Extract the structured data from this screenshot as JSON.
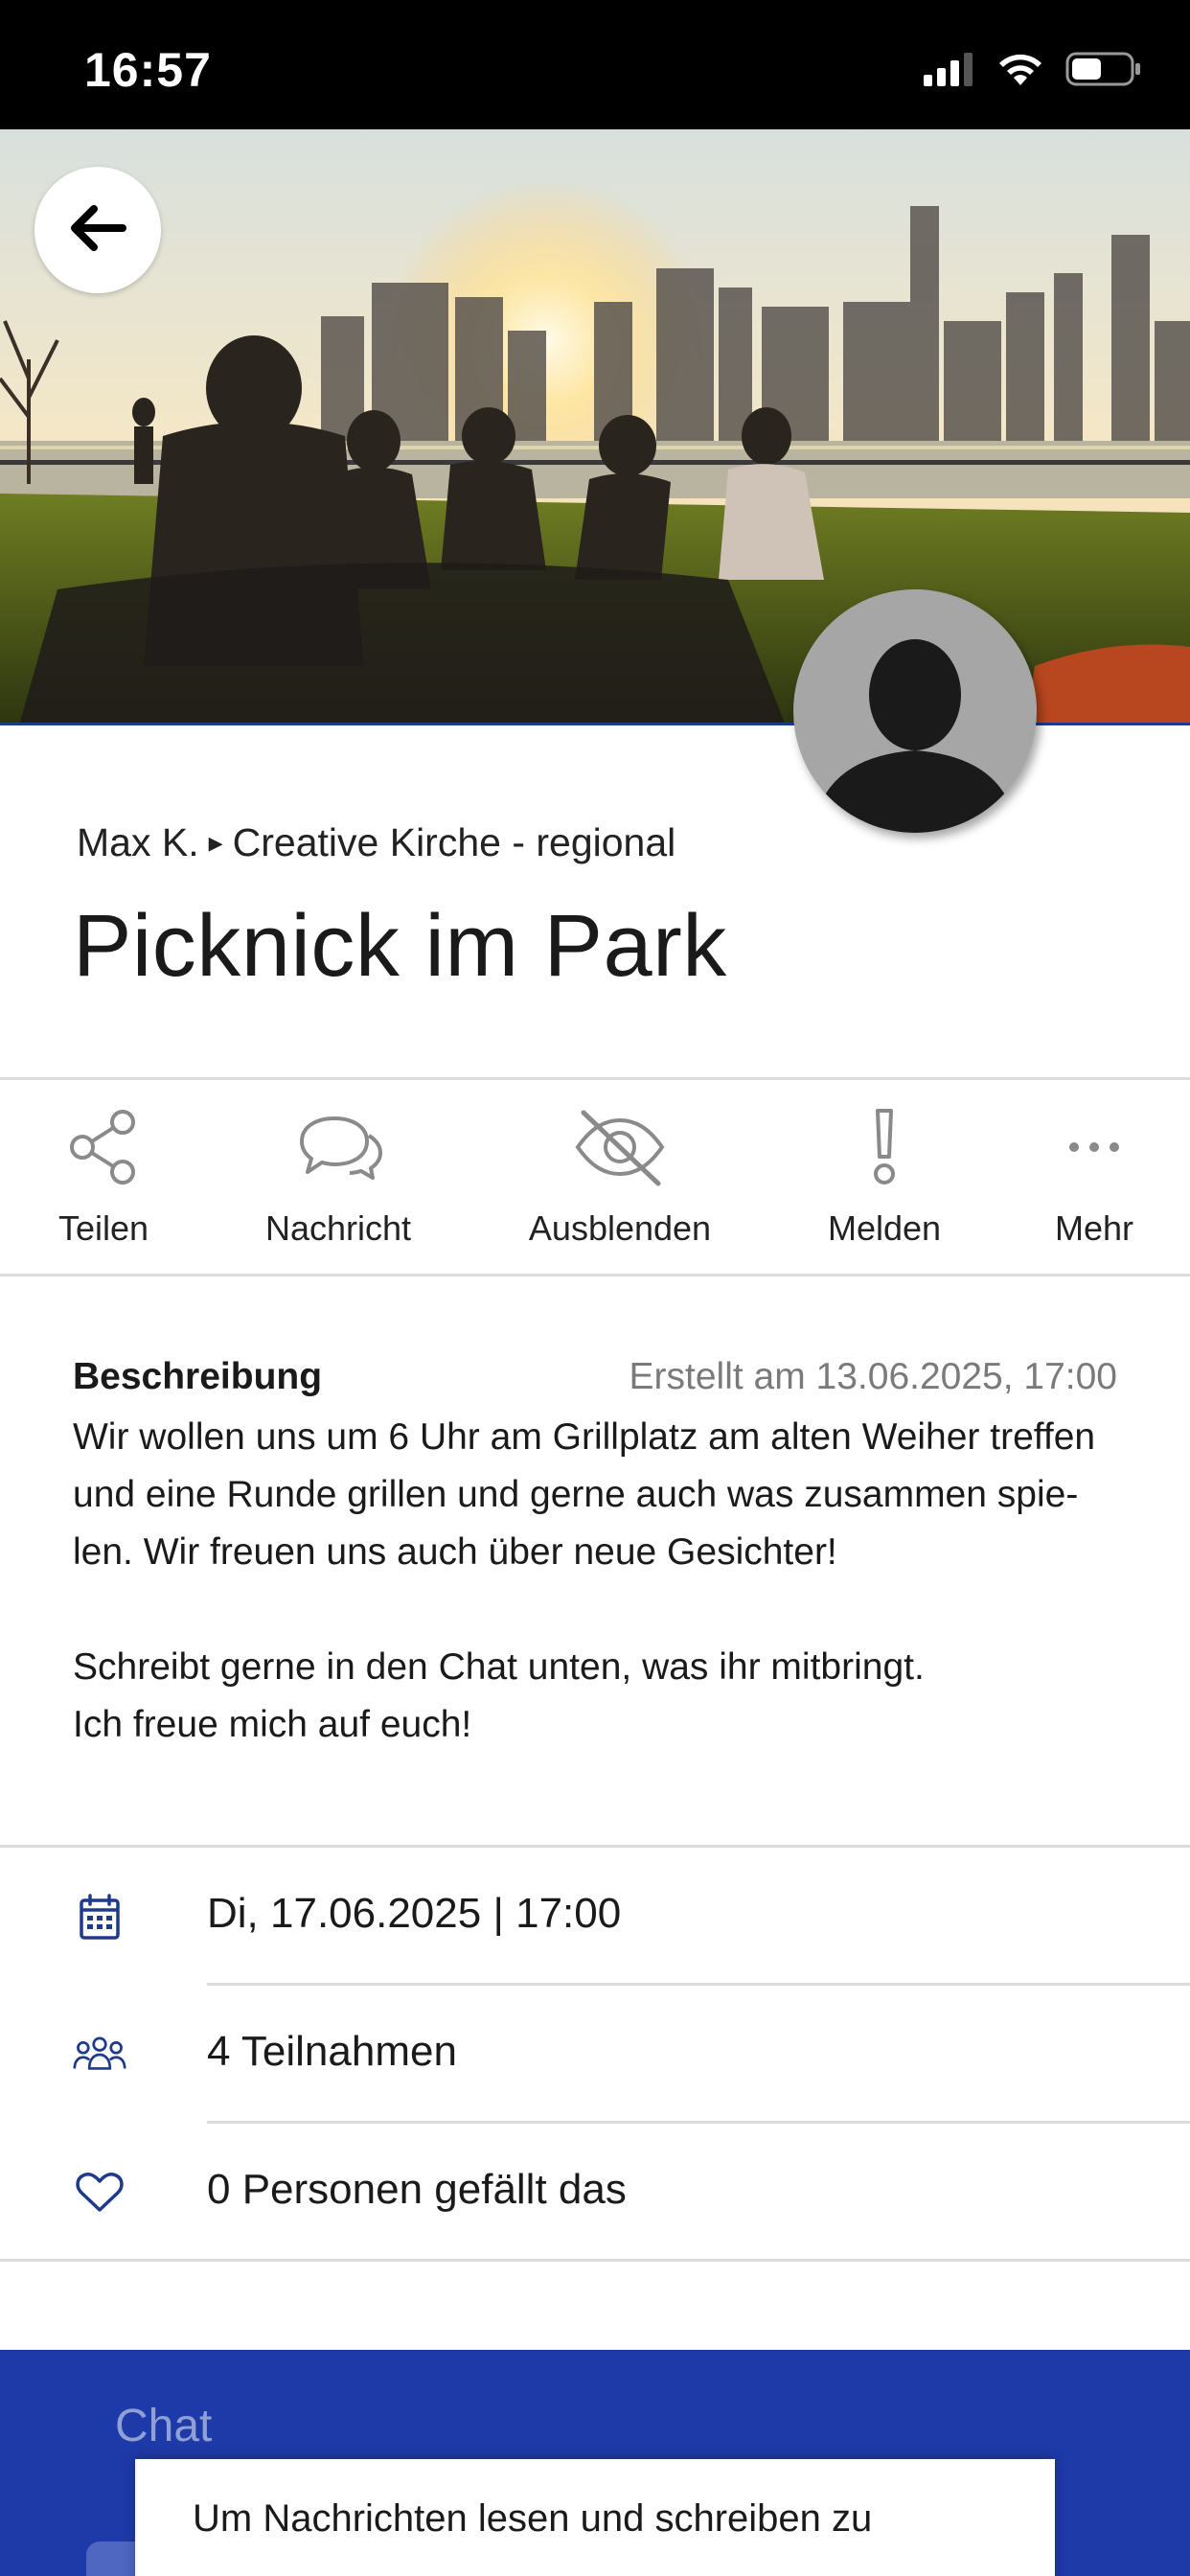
{
  "status_bar": {
    "time": "16:57"
  },
  "hero": {
    "image_icon": "city-skyline-picnic-photo"
  },
  "header": {
    "author": "Max K.",
    "separator": "▸",
    "group": "Creative Kirche - regional",
    "title": "Picknick im Park"
  },
  "actions": [
    {
      "label": "Teilen",
      "icon": "share-icon"
    },
    {
      "label": "Nachricht",
      "icon": "chat-bubbles-icon"
    },
    {
      "label": "Ausblenden",
      "icon": "eye-slash-icon"
    },
    {
      "label": "Melden",
      "icon": "exclamation-icon"
    },
    {
      "label": "Mehr",
      "icon": "more-dots-icon"
    }
  ],
  "description": {
    "label": "Beschreibung",
    "created": "Erstellt am 13.06.2025, 17:00",
    "line1": "Wir wollen uns um 6 Uhr am Grillplatz am alten Weiher treffen",
    "line2": "und eine Runde grillen und gerne auch was zusammen spie-",
    "line3": "len. Wir freuen uns auch über neue Gesichter!",
    "line4": "Schreibt gerne in den Chat unten, was ihr mitbringt.",
    "line5": "Ich freue mich auf euch!"
  },
  "info": {
    "date": "Di, 17.06.2025 | 17:00",
    "participants": "4 Teilnahmen",
    "likes": "0 Personen gefällt das"
  },
  "chat": {
    "title": "Chat",
    "login_prompt": "Um Nachrichten lesen und schreiben zu"
  },
  "colors": {
    "accent": "#1e3aa8",
    "icon_blue": "#1e3a8a",
    "divider": "#dcdcdc",
    "muted_text": "#7a7a7a"
  }
}
